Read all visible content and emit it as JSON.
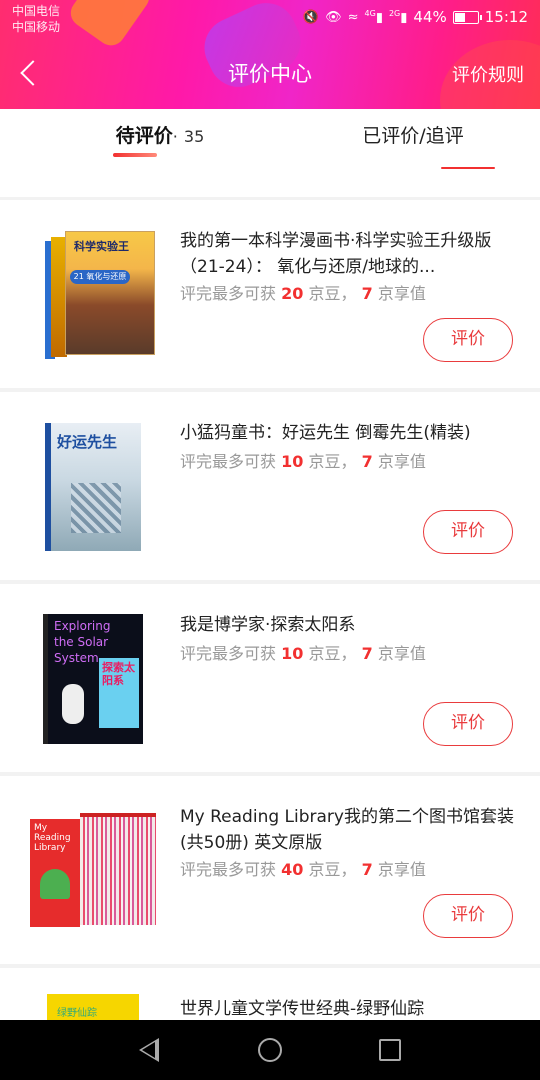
{
  "statusbar": {
    "carrier_1": "中国电信",
    "carrier_2": "中国移动",
    "signal_1_label": "4G",
    "signal_2_label": "2G",
    "battery": "44%",
    "battery_level": 0.44,
    "time": "15:12"
  },
  "nav": {
    "title": "评价中心",
    "rule_link": "评价规则"
  },
  "tabs": [
    {
      "label": "待评价",
      "separator": "·",
      "count": "35",
      "active": true
    },
    {
      "label": "已评价/追评",
      "active": false
    }
  ],
  "items": [
    {
      "title": "我的第一本科学漫画书·科学实验王升级版（21-24）： 氧化与还原/地球的...",
      "reward_prefix": "评完最多可获",
      "beans": "20",
      "beans_unit": "京豆，",
      "value": "7",
      "value_unit": "京享值",
      "button": "评价",
      "cover_text": "科学实验王",
      "cover_sub": "21 氧化与还原"
    },
    {
      "title": "小猛犸童书：好运先生 倒霉先生(精装)",
      "reward_prefix": "评完最多可获",
      "beans": "10",
      "beans_unit": "京豆，",
      "value": "7",
      "value_unit": "京享值",
      "button": "评价",
      "cover_text": "好运先生"
    },
    {
      "title": "我是博学家·探索太阳系",
      "reward_prefix": "评完最多可获",
      "beans": "10",
      "beans_unit": "京豆，",
      "value": "7",
      "value_unit": "京享值",
      "button": "评价",
      "cover_text": "Exploring the Solar System",
      "cover_sub": "探索太阳系"
    },
    {
      "title": "My Reading Library我的第二个图书馆套装(共50册) 英文原版",
      "reward_prefix": "评完最多可获",
      "beans": "40",
      "beans_unit": "京豆，",
      "value": "7",
      "value_unit": "京享值",
      "button": "评价",
      "cover_text": "My Reading Library"
    },
    {
      "title": "世界儿童文学传世经典-绿野仙踪",
      "cover_text": "绿野仙踪"
    }
  ],
  "colors": {
    "accent": "#f23030",
    "button_border": "#e93b3d",
    "header_gradient_start": "#ff2d6f",
    "header_gradient_mid": "#f025c8"
  }
}
